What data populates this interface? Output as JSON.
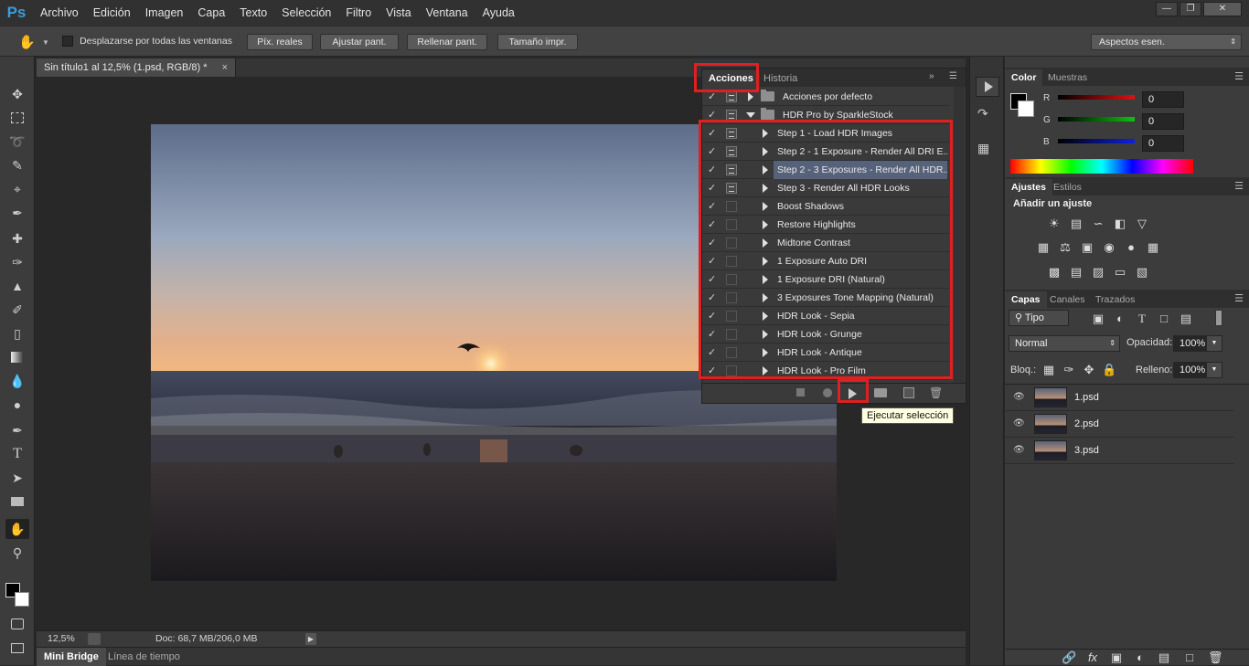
{
  "app": {
    "logo": "Ps"
  },
  "menu": [
    "Archivo",
    "Edición",
    "Imagen",
    "Capa",
    "Texto",
    "Selección",
    "Filtro",
    "Vista",
    "Ventana",
    "Ayuda"
  ],
  "options_bar": {
    "scroll_all_label": "Desplazarse por todas las ventanas",
    "buttons": [
      "Píx. reales",
      "Ajustar pant.",
      "Rellenar pant.",
      "Tamaño impr."
    ],
    "workspace": "Aspectos esen."
  },
  "document": {
    "tab_title": "Sin título1 al 12,5% (1.psd, RGB/8) *",
    "zoom": "12,5%",
    "doc_info": "Doc: 68,7 MB/206,0 MB"
  },
  "bottom_tabs": [
    "Mini Bridge",
    "Línea de tiempo"
  ],
  "actions_panel": {
    "tabs": [
      "Acciones",
      "Historia"
    ],
    "sets": [
      {
        "name": "Acciones por defecto",
        "expanded": false
      },
      {
        "name": "HDR Pro by SparkleStock",
        "expanded": true
      }
    ],
    "actions": [
      {
        "name": "Step 1 - Load HDR Images",
        "dialog": true,
        "selected": false
      },
      {
        "name": "Step 2 - 1 Exposure - Render All DRI E...",
        "dialog": true,
        "selected": false
      },
      {
        "name": "Step 2 - 3 Exposures - Render All HDR...",
        "dialog": true,
        "selected": true
      },
      {
        "name": "Step 3 - Render All HDR Looks",
        "dialog": true,
        "selected": false
      },
      {
        "name": "Boost Shadows",
        "dialog": false,
        "selected": false
      },
      {
        "name": "Restore Highlights",
        "dialog": false,
        "selected": false
      },
      {
        "name": "Midtone Contrast",
        "dialog": false,
        "selected": false
      },
      {
        "name": "1 Exposure Auto DRI",
        "dialog": false,
        "selected": false
      },
      {
        "name": "1 Exposure DRI (Natural)",
        "dialog": false,
        "selected": false
      },
      {
        "name": "3 Exposures Tone Mapping (Natural)",
        "dialog": false,
        "selected": false
      },
      {
        "name": "HDR Look - Sepia",
        "dialog": false,
        "selected": false
      },
      {
        "name": "HDR Look - Grunge",
        "dialog": false,
        "selected": false
      },
      {
        "name": "HDR Look - Antique",
        "dialog": false,
        "selected": false
      },
      {
        "name": "HDR Look - Pro Film",
        "dialog": false,
        "selected": false
      }
    ],
    "tooltip": "Ejecutar selección"
  },
  "color_panel": {
    "tabs": [
      "Color",
      "Muestras"
    ],
    "channels": [
      {
        "label": "R",
        "value": "0",
        "color": "#e01010"
      },
      {
        "label": "G",
        "value": "0",
        "color": "#10c010"
      },
      {
        "label": "B",
        "value": "0",
        "color": "#1020e0"
      }
    ]
  },
  "adjustments_panel": {
    "tabs": [
      "Ajustes",
      "Estilos"
    ],
    "heading": "Añadir un ajuste"
  },
  "layers_panel": {
    "tabs": [
      "Capas",
      "Canales",
      "Trazados"
    ],
    "filter": "Tipo",
    "blend_mode": "Normal",
    "opacity_label": "Opacidad:",
    "opacity": "100%",
    "lock_label": "Bloq.:",
    "fill_label": "Relleno:",
    "fill": "100%",
    "layers": [
      {
        "name": "1.psd",
        "selected": true
      },
      {
        "name": "2.psd",
        "selected": false
      },
      {
        "name": "3.psd",
        "selected": false
      }
    ]
  },
  "colors": {
    "accent": "#3b9dd8",
    "highlight": "#e02020",
    "selection": "#56627a"
  }
}
